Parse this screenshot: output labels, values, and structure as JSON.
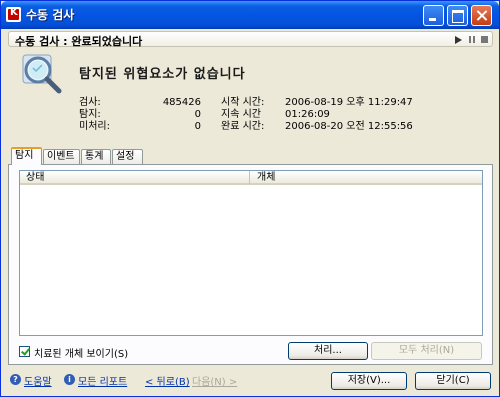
{
  "window": {
    "title": "수동 검사",
    "app_icon_letter": "K"
  },
  "status": {
    "text": "수동 검사 : 완료되었습니다"
  },
  "summary": {
    "headline": "탐지된 위협요소가 없습니다",
    "stats": [
      {
        "label": "검사:",
        "value": "485426"
      },
      {
        "label": "탐지:",
        "value": "0"
      },
      {
        "label": "미처리:",
        "value": "0"
      }
    ],
    "times": [
      {
        "label": "시작 시간:",
        "value": "2006-08-19 오후 11:29:47"
      },
      {
        "label": "지속 시간",
        "value": "01:26:09"
      },
      {
        "label": "완료 시간:",
        "value": "2006-08-20 오전 12:55:56"
      }
    ]
  },
  "tabs": [
    {
      "label": "탐지",
      "active": true
    },
    {
      "label": "이벤트",
      "active": false
    },
    {
      "label": "통계",
      "active": false
    },
    {
      "label": "설정",
      "active": false
    }
  ],
  "table": {
    "columns": [
      "상태",
      "개체"
    ],
    "rows": []
  },
  "options": {
    "show_treated_label": "치료된 개체 보이기(S)",
    "show_treated_checked": true
  },
  "buttons": {
    "process": "처리...",
    "process_all": "모두 처리(N)",
    "save": "저장(V)...",
    "close": "닫기(C)"
  },
  "footer": {
    "help": "도움말",
    "all_reports": "모든 리포트",
    "back": "< 뒤로(B)",
    "next": "다음(N) >"
  },
  "colors": {
    "titlebar": "#0554E3",
    "accent_tab": "#E6A02A",
    "link": "#0033AA"
  }
}
